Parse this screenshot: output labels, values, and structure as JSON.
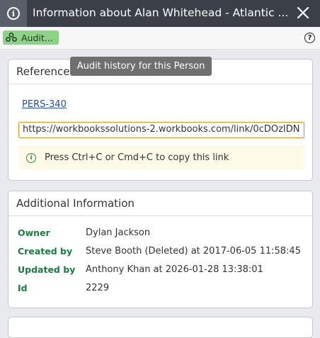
{
  "titlebar": {
    "title": "Information about Alan Whitehead - Atlantic ...",
    "info_icon": "info-icon",
    "close_icon": "close-icon"
  },
  "toolbar": {
    "audit_label": "Audit...",
    "audit_icon": "people-group-icon",
    "help_icon": "question-icon",
    "tooltip": "Audit history for this Person"
  },
  "reference": {
    "heading": "Reference",
    "id_link": "PERS-340",
    "link_value": "https://workbookssolutions-2.workbooks.com/link/0cDOzIDN",
    "hint": "Press Ctrl+C or Cmd+C to copy this link"
  },
  "additional": {
    "heading": "Additional Information",
    "rows": [
      {
        "key": "Owner",
        "value": "Dylan Jackson"
      },
      {
        "key": "Created by",
        "value": "Steve Booth (Deleted) at 2017-06-05 11:58:45"
      },
      {
        "key": "Updated by",
        "value": "Anthony Khan at 2026-01-28 13:38:01"
      },
      {
        "key": "Id",
        "value": "2229"
      }
    ]
  },
  "colors": {
    "titlebar": "#3b4048",
    "audit_button": "#8fd08a",
    "field_label": "#1e7a43",
    "input_border": "#e08a1c"
  }
}
